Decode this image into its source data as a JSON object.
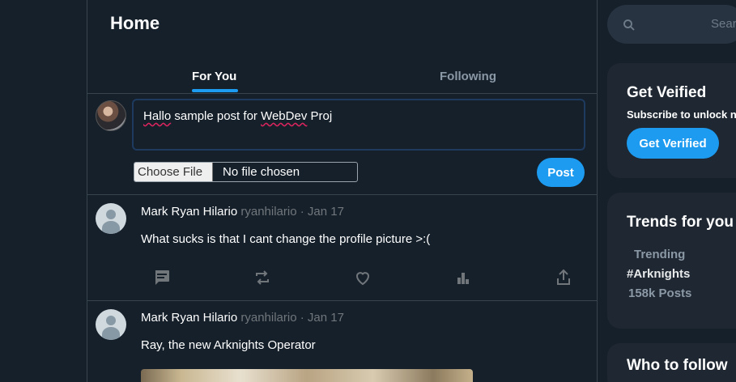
{
  "header": {
    "title": "Home",
    "tabs": [
      {
        "label": "For You",
        "active": true
      },
      {
        "label": "Following",
        "active": false
      }
    ]
  },
  "composer": {
    "text_part1": "Hallo",
    "text_part2": " sample post for ",
    "text_part3": "WebDev",
    "text_part4": " Proj",
    "file_button": "Choose File",
    "file_status": "No file chosen",
    "post_button": "Post"
  },
  "posts": [
    {
      "author": "Mark Ryan Hilario",
      "handle": "ryanhilario",
      "separator": " · ",
      "date": "Jan 17",
      "text": "What sucks is that I cant change the profile picture >:("
    },
    {
      "author": "Mark Ryan Hilario",
      "handle": "ryanhilario",
      "separator": " · ",
      "date": "Jan 17",
      "text": "Ray, the new Arknights Operator"
    }
  ],
  "sidebar": {
    "search_placeholder": "Sear",
    "verified": {
      "title": "Get Veified",
      "subtitle": "Subscribe to unlock n",
      "button": "Get Verified"
    },
    "trends": {
      "title": "Trends for you",
      "label": "Trending",
      "tag": "#Arknights",
      "count": "158k Posts"
    },
    "follow": {
      "title": "Who to follow"
    }
  },
  "colors": {
    "background": "#15202b",
    "accent": "#1d9bf0",
    "card": "#1e2732",
    "border": "#38444d"
  },
  "icons": [
    "comment-icon",
    "retweet-icon",
    "heart-icon",
    "analytics-icon",
    "share-icon",
    "search-icon"
  ]
}
